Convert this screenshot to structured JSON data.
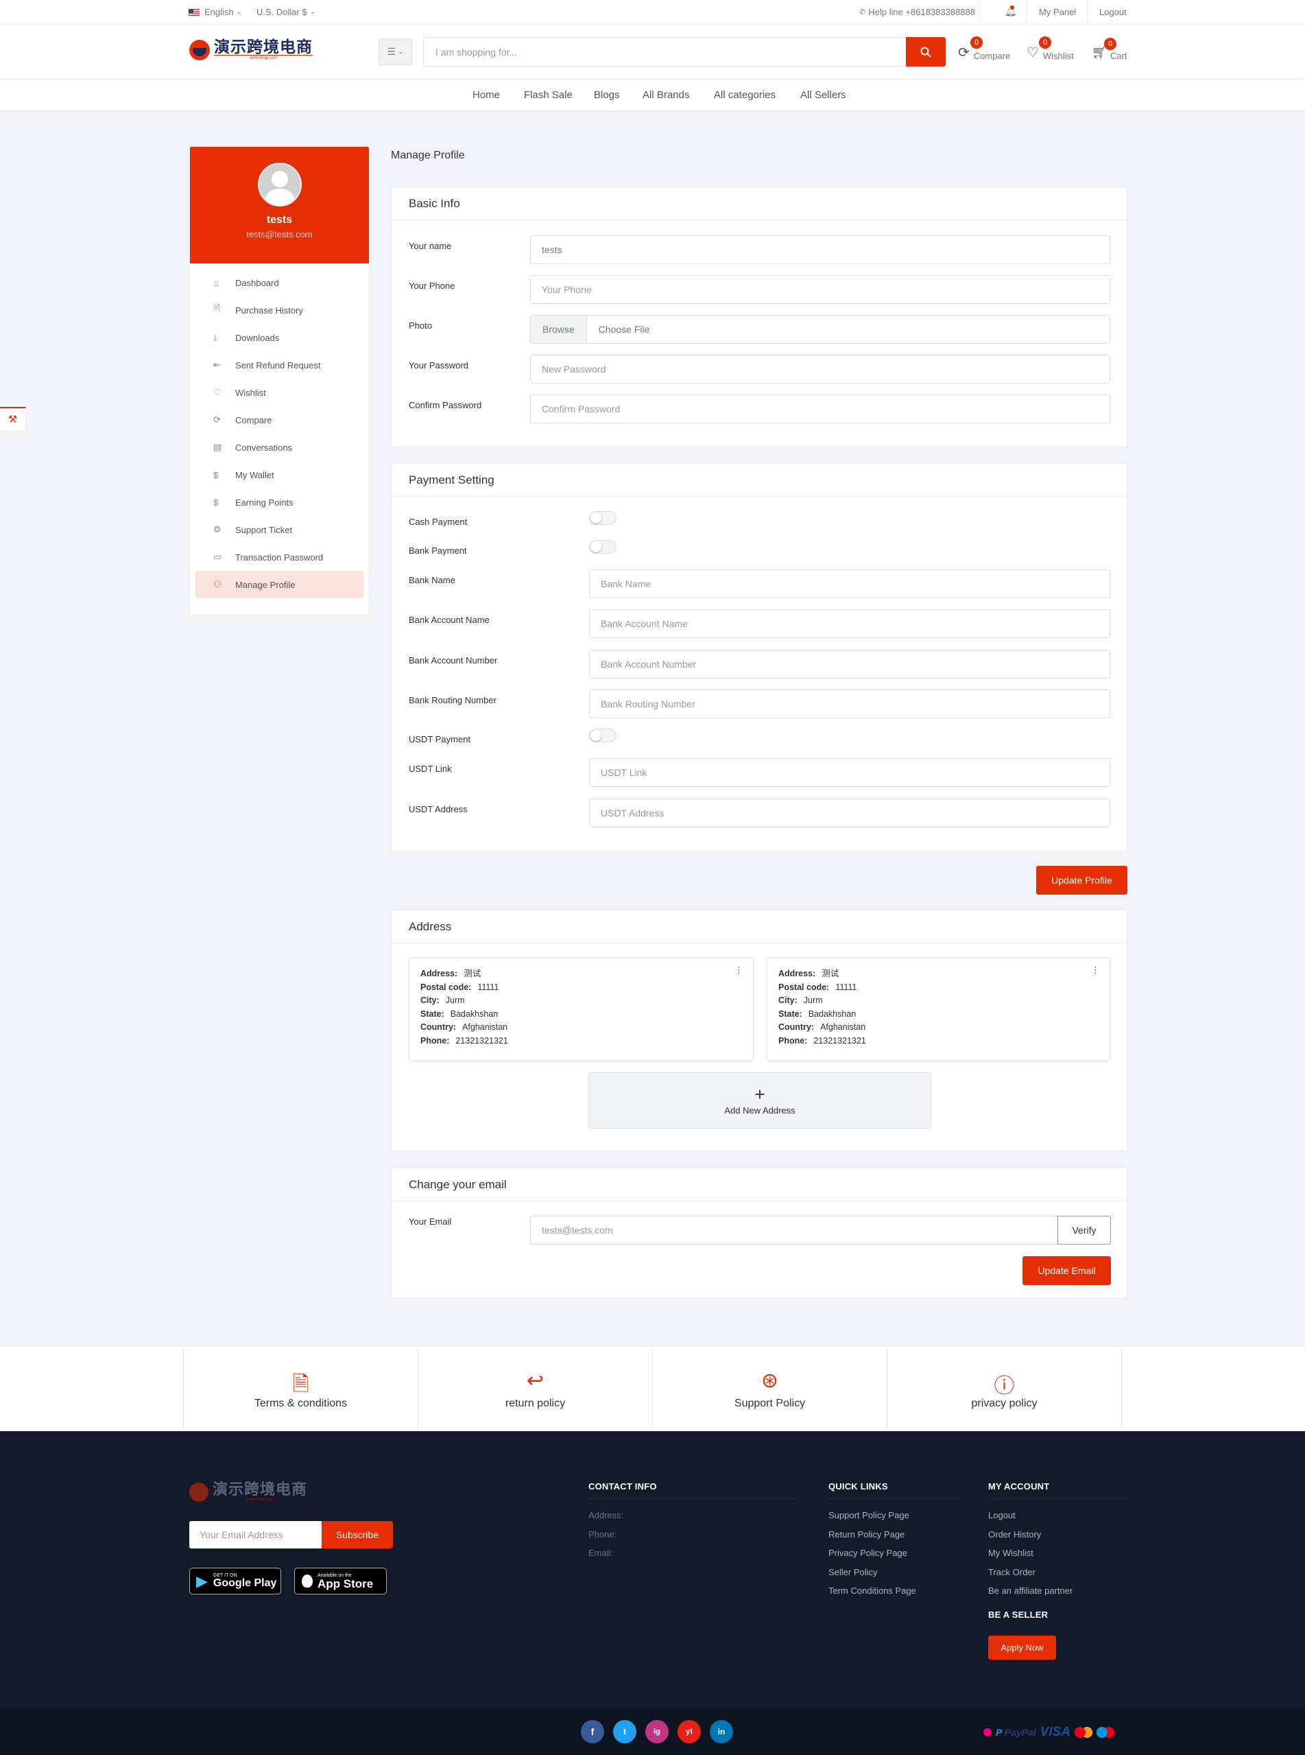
{
  "colors": {
    "accent": "#e62e04",
    "footer_bg": "#141a29",
    "nav_active_bg": "#fbe0dc"
  },
  "topbar": {
    "language": "English",
    "currency": "U.S. Dollar $",
    "helpline": "Help line +8618383388888",
    "my_panel": "My Panel",
    "logout": "Logout"
  },
  "header": {
    "logo_text": "演示跨境电商",
    "logo_subtext": "www.shop.com",
    "search_placeholder": "I am shopping for...",
    "compare_label": "Compare",
    "compare_count": "0",
    "wishlist_label": "Wishlist",
    "wishlist_count": "0",
    "cart_label": "Cart",
    "cart_count": "0"
  },
  "nav": [
    "Home",
    "Flash Sale",
    "Blogs",
    "All Brands",
    "All categories",
    "All Sellers"
  ],
  "profile": {
    "name": "tests",
    "email": "tests@tests.com"
  },
  "sidebar": [
    {
      "label": "Dashboard",
      "icon": "home-icon"
    },
    {
      "label": "Purchase History",
      "icon": "file-icon"
    },
    {
      "label": "Downloads",
      "icon": "download-icon"
    },
    {
      "label": "Sent Refund Request",
      "icon": "refund-icon"
    },
    {
      "label": "Wishlist",
      "icon": "heart-icon"
    },
    {
      "label": "Compare",
      "icon": "refresh-icon"
    },
    {
      "label": "Conversations",
      "icon": "message-icon"
    },
    {
      "label": "My Wallet",
      "icon": "dollar-icon"
    },
    {
      "label": "Earning Points",
      "icon": "dollar-icon"
    },
    {
      "label": "Support Ticket",
      "icon": "gear-icon"
    },
    {
      "label": "Transaction Password",
      "icon": "wallet-icon"
    },
    {
      "label": "Manage Profile",
      "icon": "user-icon"
    }
  ],
  "page_title": "Manage Profile",
  "basic_info": {
    "title": "Basic Info",
    "name_label": "Your name",
    "name_value": "tests",
    "phone_label": "Your Phone",
    "phone_placeholder": "Your Phone",
    "photo_label": "Photo",
    "browse_label": "Browse",
    "choose_file": "Choose File",
    "password_label": "Your Password",
    "password_placeholder": "New Password",
    "confirm_label": "Confirm Password",
    "confirm_placeholder": "Confirm Password"
  },
  "payment": {
    "title": "Payment Setting",
    "cash_label": "Cash Payment",
    "bank_label": "Bank Payment",
    "bank_name_label": "Bank Name",
    "bank_name_placeholder": "Bank Name",
    "bank_acc_name_label": "Bank Account Name",
    "bank_acc_name_placeholder": "Bank Account Name",
    "bank_acc_num_label": "Bank Account Number",
    "bank_acc_num_placeholder": "Bank Account Number",
    "bank_routing_label": "Bank Routing Number",
    "bank_routing_placeholder": "Bank Routing Number",
    "usdt_label": "USDT Payment",
    "usdt_link_label": "USDT Link",
    "usdt_link_placeholder": "USDT Link",
    "usdt_address_label": "USDT Address",
    "usdt_address_placeholder": "USDT Address"
  },
  "update_profile": "Update Profile",
  "address": {
    "title": "Address",
    "field_labels": {
      "address": "Address:",
      "postal": "Postal code:",
      "city": "City:",
      "state": "State:",
      "country": "Country:",
      "phone": "Phone:"
    },
    "items": [
      {
        "address": "测试",
        "postal": "11111",
        "city": "Jurm",
        "state": "Badakhshan",
        "country": "Afghanistan",
        "phone": "21321321321"
      },
      {
        "address": "测试",
        "postal": "11111",
        "city": "Jurm",
        "state": "Badakhshan",
        "country": "Afghanistan",
        "phone": "21321321321"
      }
    ],
    "add_new": "Add New Address"
  },
  "email_section": {
    "title": "Change your email",
    "label": "Your Email",
    "value": "tests@tests.com",
    "verify": "Verify",
    "update": "Update Email"
  },
  "policies": [
    "Terms & conditions",
    "return policy",
    "Support Policy",
    "privacy policy"
  ],
  "footer": {
    "email_placeholder": "Your Email Address",
    "subscribe": "Subscribe",
    "google_small": "GET IT ON",
    "google_big": "Google Play",
    "apple_small": "Available on the",
    "apple_big": "App Store",
    "contact_title": "CONTACT INFO",
    "contact": [
      "Address:",
      "Phone:",
      "Email:"
    ],
    "quick_title": "QUICK LINKS",
    "quick": [
      "Support Policy Page",
      "Return Policy Page",
      "Privacy Policy Page",
      "Seller Policy",
      "Term Conditions Page"
    ],
    "account_title": "MY ACCOUNT",
    "account": [
      "Logout",
      "Order History",
      "My Wishlist",
      "Track Order",
      "Be an affiliate partner"
    ],
    "seller_title": "BE A SELLER",
    "apply": "Apply Now",
    "social": [
      "f",
      "t",
      "ig",
      "yt",
      "in"
    ],
    "payment_logos": [
      "PayPal",
      "VISA"
    ]
  }
}
